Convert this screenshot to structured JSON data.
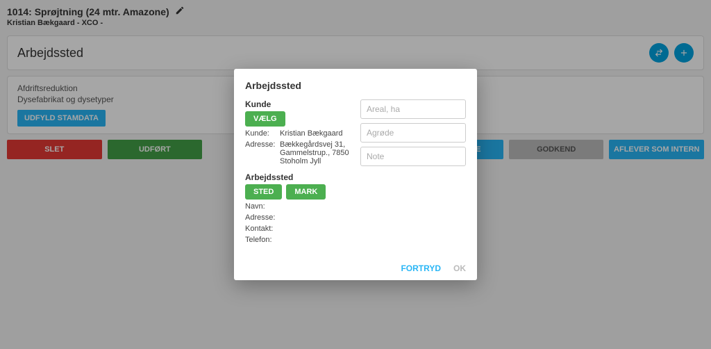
{
  "header": {
    "title": "1014: Sprøjtning (24 mtr. Amazone)",
    "subtitle": "Kristian Bækgaard - XCO -"
  },
  "section": {
    "title": "Arbejdssted"
  },
  "info": {
    "line1": "Afdriftsreduktion",
    "line2": "Dysefabrikat og dysetyper",
    "button": "UDFYLD STAMDATA"
  },
  "actions": {
    "delete": "SLET",
    "done": "UDFØRT",
    "take": "TAG OPGAVE",
    "approve": "GODKEND",
    "deliver": "AFLEVER SOM INTERN"
  },
  "modal": {
    "title": "Arbejdssted",
    "kunde_label": "Kunde",
    "vaelg": "VÆLG",
    "kunde_key": "Kunde:",
    "kunde_val": "Kristian Bækgaard",
    "adresse_key": "Adresse:",
    "adresse_val": "Bækkegårdsvej 31, Gammelstrup., 7850 Stoholm Jyll",
    "arbejdssted_label": "Arbejdssted",
    "sted": "STED",
    "mark": "MARK",
    "navn_key": "Navn:",
    "navn_val": "",
    "adresse2_key": "Adresse:",
    "adresse2_val": "",
    "kontakt_key": "Kontakt:",
    "kontakt_val": "",
    "telefon_key": "Telefon:",
    "telefon_val": "",
    "ph_areal": "Areal, ha",
    "ph_afgroede": "Agrøde",
    "ph_note": "Note",
    "cancel": "FORTRYD",
    "ok": "OK"
  }
}
